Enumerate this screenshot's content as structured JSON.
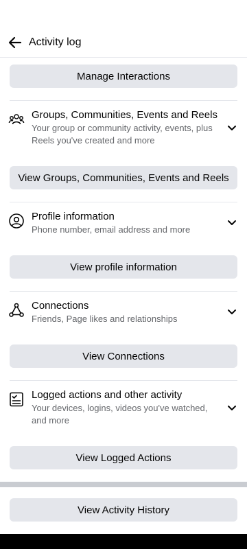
{
  "header": {
    "title": "Activity log"
  },
  "buttons": {
    "manage_interactions": "Manage Interactions",
    "view_groups": "View Groups, Communities, Events and Reels",
    "view_profile": "View profile information",
    "view_connections": "View Connections",
    "view_logged": "View Logged Actions",
    "view_history": "View Activity History"
  },
  "sections": [
    {
      "title": "Groups, Communities, Events and Reels",
      "subtitle": "Your group or community activity, events, plus Reels you've created and more",
      "icon": "groups-icon"
    },
    {
      "title": "Profile information",
      "subtitle": "Phone number, email address and more",
      "icon": "profile-icon"
    },
    {
      "title": "Connections",
      "subtitle": "Friends, Page likes and relationships",
      "icon": "connections-icon"
    },
    {
      "title": "Logged actions and other activity",
      "subtitle": "Your devices, logins, videos you've watched, and more",
      "icon": "checklist-icon"
    }
  ]
}
